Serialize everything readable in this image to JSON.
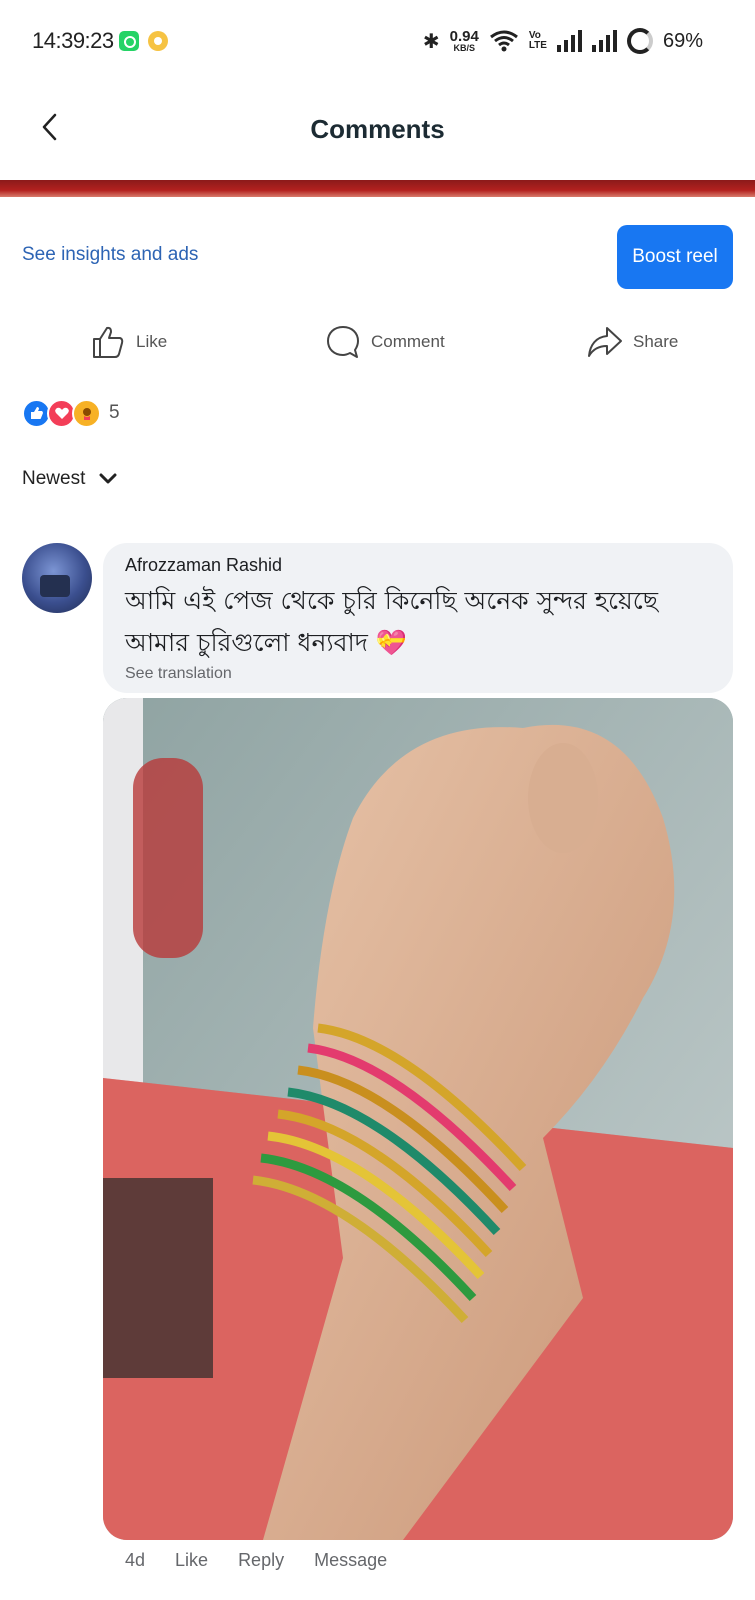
{
  "status_bar": {
    "time": "14:39:23",
    "net_speed": "0.94",
    "net_unit": "KB/S",
    "volte_top": "Vo",
    "volte_bottom": "LTE",
    "battery": "69%"
  },
  "header": {
    "title": "Comments",
    "back_icon": "chevron-left-icon"
  },
  "post": {
    "insights_label": "See insights and ads",
    "boost_label": "Boost reel",
    "actions": {
      "like_label": "Like",
      "comment_label": "Comment",
      "share_label": "Share"
    },
    "reaction_icons": [
      "like-reaction-icon",
      "love-reaction-icon",
      "care-reaction-icon"
    ],
    "reaction_count": "5"
  },
  "sort": {
    "label": "Newest"
  },
  "comment": {
    "author": "Afrozzaman Rashid",
    "text": "আমি এই পেজ থেকে চুরি কিনেছি অনেক সুন্দর হয়েছে আমার চুরিগুলো ধন্যবাদ 💝",
    "see_translation": "See translation",
    "time": "4d",
    "like_label": "Like",
    "reply_label": "Reply",
    "message_label": "Message"
  },
  "colors": {
    "accent": "#1877f2",
    "link": "#2d64b4",
    "bubble": "#f0f2f5"
  }
}
